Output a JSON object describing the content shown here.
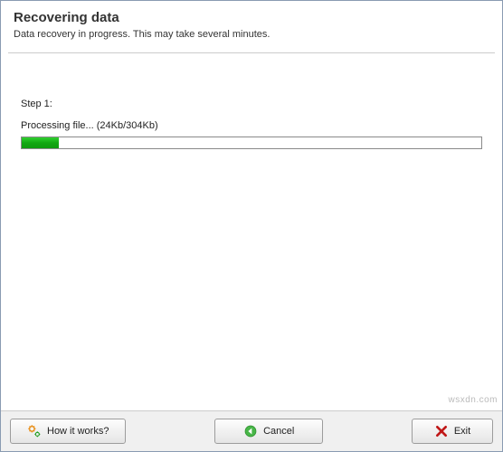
{
  "header": {
    "title": "Recovering data",
    "subtitle": "Data recovery in progress. This may take several minutes."
  },
  "content": {
    "step_label": "Step 1:",
    "processing_label": "Processing file... (24Kb/304Kb)",
    "progress_percent": 8
  },
  "buttons": {
    "how_it_works": "How it works?",
    "cancel": "Cancel",
    "exit": "Exit"
  },
  "watermark": "wsxdn.com"
}
